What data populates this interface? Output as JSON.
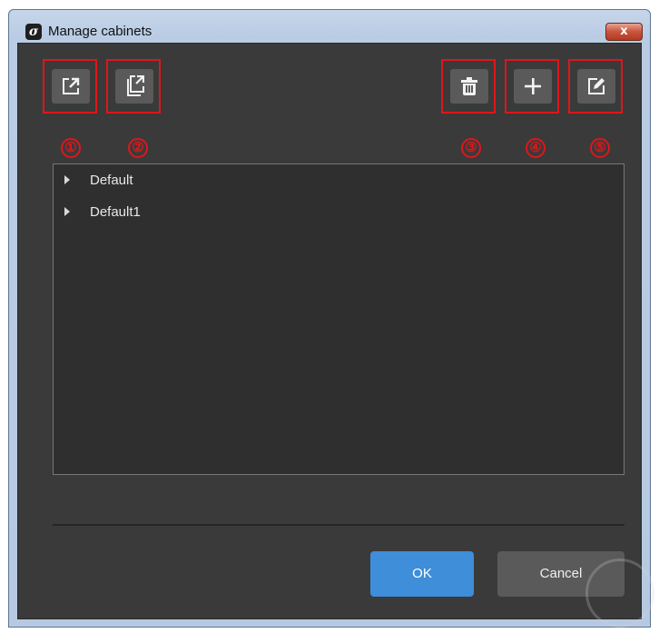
{
  "window": {
    "title": "Manage cabinets",
    "close_glyph": "x"
  },
  "toolbar": {
    "left_buttons": [
      {
        "icon": "export-icon",
        "badge": "①"
      },
      {
        "icon": "export-all-icon",
        "badge": "②"
      }
    ],
    "right_buttons": [
      {
        "icon": "trash-icon",
        "badge": "③"
      },
      {
        "icon": "plus-icon",
        "badge": "④"
      },
      {
        "icon": "edit-icon",
        "badge": "⑤"
      }
    ]
  },
  "tree": {
    "items": [
      {
        "label": "Default"
      },
      {
        "label": "Default1"
      }
    ]
  },
  "footer": {
    "ok_label": "OK",
    "cancel_label": "Cancel"
  },
  "colors": {
    "annotation": "#e0151b",
    "primary": "#3e8ed9",
    "panel_bg": "#3a3a3a"
  }
}
